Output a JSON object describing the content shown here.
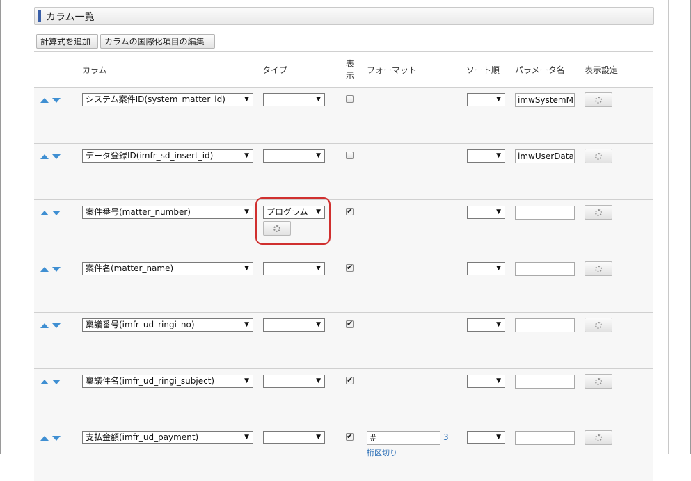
{
  "section": {
    "title": "カラム一覧"
  },
  "toolbar": {
    "add_formula": "計算式を追加",
    "edit_i18n": "カラムの国際化項目の編集"
  },
  "headers": {
    "column": "カラム",
    "type": "タイプ",
    "display_line1": "表",
    "display_line2": "示",
    "format": "フォーマット",
    "sort": "ソート順",
    "param": "パラメータ名",
    "display_settings": "表示設定"
  },
  "rows": [
    {
      "column": "システム案件ID(system_matter_id)",
      "type": "",
      "checked": false,
      "sort": "",
      "param": "imwSystemM"
    },
    {
      "column": "データ登録ID(imfr_sd_insert_id)",
      "type": "",
      "checked": false,
      "sort": "",
      "param": "imwUserData"
    },
    {
      "column": "案件番号(matter_number)",
      "type": "プログラム",
      "checked": true,
      "sort": "",
      "param": ""
    },
    {
      "column": "案件名(matter_name)",
      "type": "",
      "checked": true,
      "sort": "",
      "param": ""
    },
    {
      "column": "稟議番号(imfr_ud_ringi_no)",
      "type": "",
      "checked": true,
      "sort": "",
      "param": ""
    },
    {
      "column": "稟議件名(imfr_ud_ringi_subject)",
      "type": "",
      "checked": true,
      "sort": "",
      "param": ""
    },
    {
      "column": "支払金額(imfr_ud_payment)",
      "type": "",
      "checked": true,
      "sort": "",
      "param": "",
      "format": "#",
      "format_digits": "3",
      "format_link": "桁区切り"
    }
  ],
  "icons": {
    "move_up": "triangle-up-icon",
    "move_down": "triangle-down-icon",
    "settings": "gear-icon",
    "dropdown": "chevron-down-icon"
  },
  "colors": {
    "accent": "#3a5fa8",
    "arrow": "#3f8fd2",
    "highlight": "#d0302f",
    "link": "#2b6fb7"
  }
}
